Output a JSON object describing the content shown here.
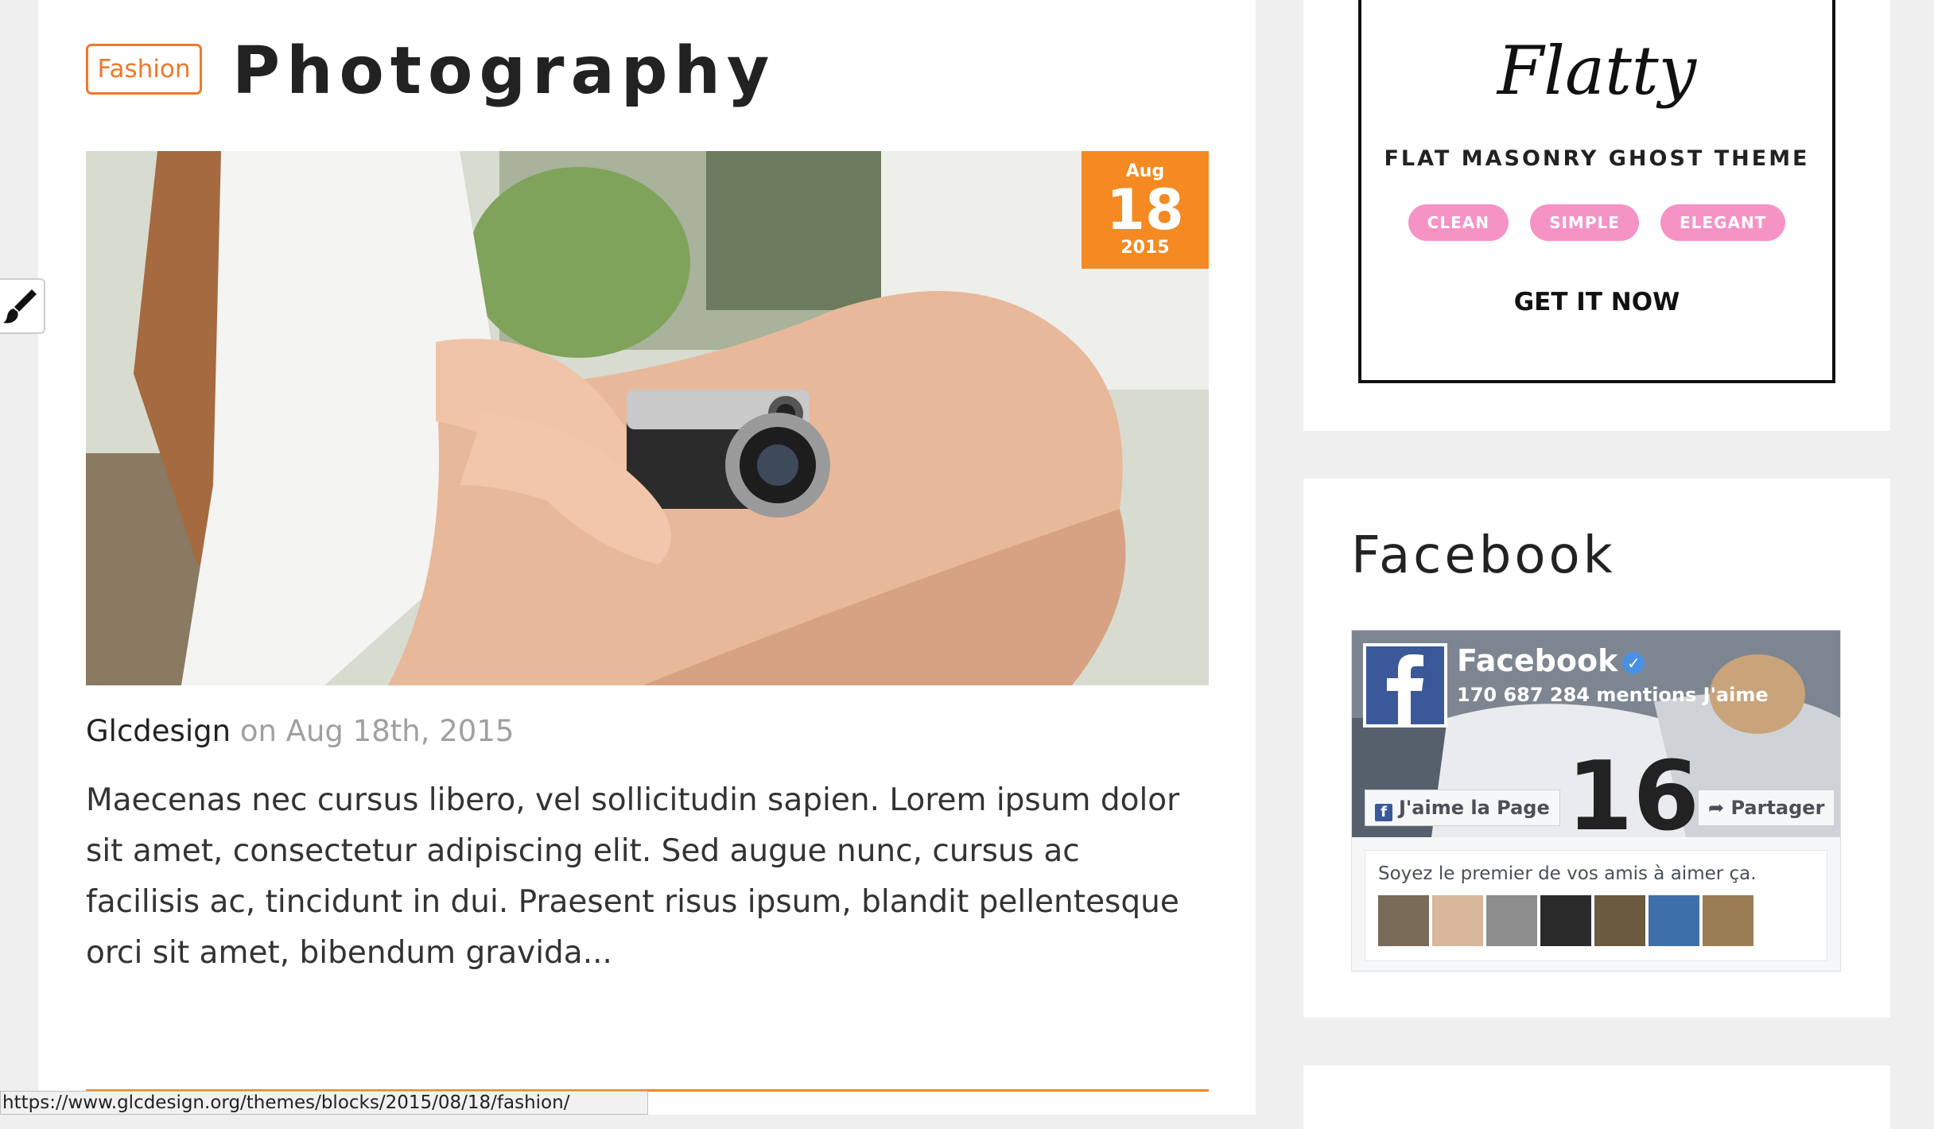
{
  "post": {
    "category": "Fashion",
    "title": "Photography",
    "date_badge": {
      "month": "Aug",
      "day": "18",
      "year": "2015"
    },
    "author": "Glcdesign",
    "meta_sep": "on",
    "date": "Aug 18th, 2015",
    "excerpt": "Maecenas nec cursus libero, vel sollicitudin sapien. Lorem ipsum dolor sit amet, consectetur adipiscing elit. Sed augue nunc, cursus ac facilisis ac, tincidunt in dui. Praesent risus ipsum, blandit pellentesque orci sit amet, bibendum gravida..."
  },
  "status_bar": {
    "url": "https://www.glcdesign.org/themes/blocks/2015/08/18/fashion/"
  },
  "ad": {
    "logo": "Flatty",
    "subtitle": "FLAT MASONRY  GHOST THEME",
    "tags": [
      "CLEAN",
      "SIMPLE",
      "ELEGANT"
    ],
    "cta": "GET IT NOW"
  },
  "facebook_widget": {
    "heading": "Facebook",
    "page_name": "Facebook",
    "likes": "170 687 284 mentions J'aime",
    "like_button": "J'aime la Page",
    "share_button": "Partager",
    "friends_text": "Soyez le premier de vos amis à aimer ça."
  },
  "colors": {
    "accent": "#f48a21",
    "tag_pink": "#f693c5",
    "facebook_blue": "#3b5998"
  },
  "icons": [
    "paintbrush-icon",
    "facebook-f-icon",
    "verified-check-icon",
    "share-arrow-icon"
  ]
}
